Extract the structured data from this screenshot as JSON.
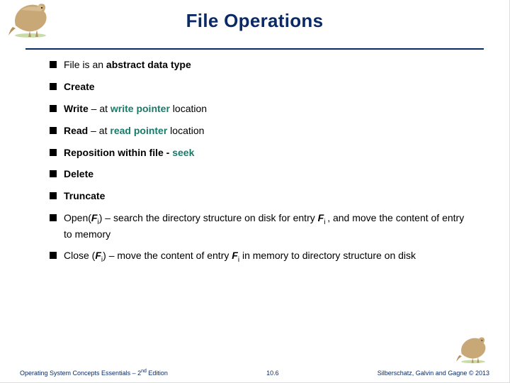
{
  "title": "File Operations",
  "bullets": {
    "b0": {
      "pre": "File is an ",
      "bold1": "abstract data type"
    },
    "b1": {
      "bold1": "Create"
    },
    "b2": {
      "bold1": "Write",
      "mid": " – at ",
      "teal": "write pointer",
      "post": " location"
    },
    "b3": {
      "bold1": "Read",
      "mid": " – at ",
      "teal": "read pointer",
      "post": " location"
    },
    "b4": {
      "bold1": "Reposition within file - ",
      "teal": "seek"
    },
    "b5": {
      "bold1": "Delete"
    },
    "b6": {
      "bold1": "Truncate"
    },
    "b7": {
      "pre": "Open(",
      "ital": "F",
      "sub": "i",
      "post1": ") – search the directory structure on disk for entry ",
      "ital2": "F",
      "sub2": "i ",
      "post2": ", and move the content of entry to memory"
    },
    "b8": {
      "pre": "Close (",
      "ital": "F",
      "sub": "i",
      "post1": ") – move the content of entry ",
      "ital2": "F",
      "sub2": "i",
      "post2": " in memory to directory structure on disk"
    }
  },
  "footer": {
    "left1": "Operating System Concepts Essentials – 2",
    "left_sup": "nd",
    "left2": " Edition",
    "center": "10.6",
    "right": "Silberschatz, Galvin and Gagne © 2013"
  }
}
